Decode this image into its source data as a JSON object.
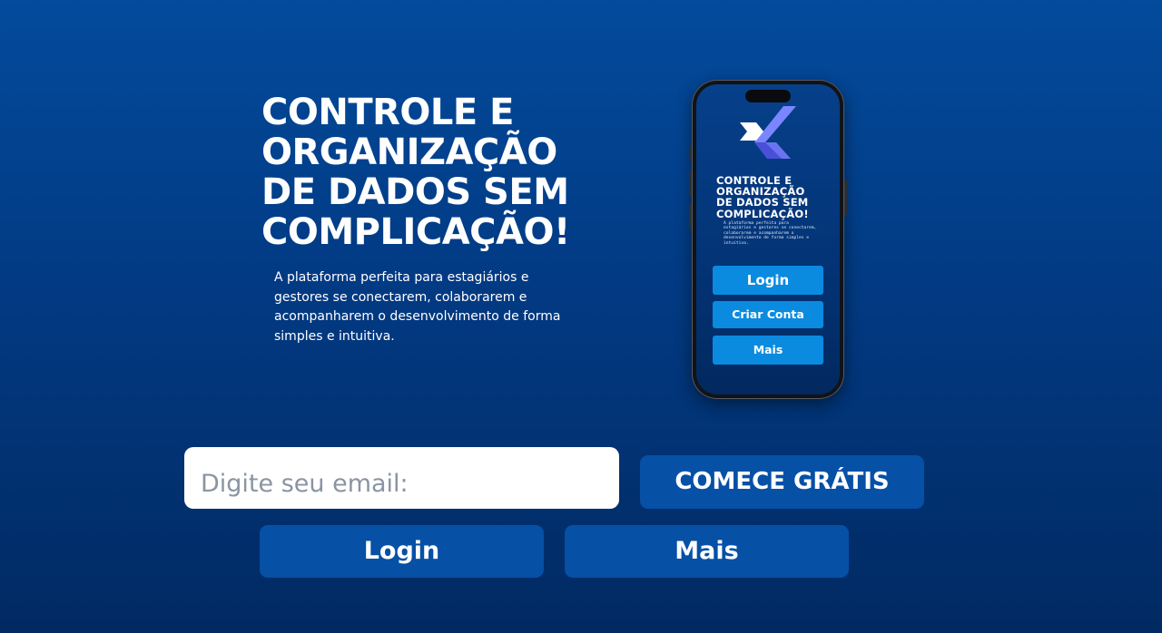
{
  "hero": {
    "title": "CONTROLE E\nORGANIZAÇÃO\nDE DADOS SEM\nCOMPLICAÇÃO!",
    "subtitle": "A plataforma perfeita para estagiários e gestores se conectarem, colaborarem e acompanharem o desenvolvimento de forma simples e intuitiva."
  },
  "phone": {
    "logo_icon": "x-logo-icon",
    "title": "CONTROLE E\nORGANIZAÇÃO\nDE DADOS SEM\nCOMPLICAÇÃO!",
    "description": "A plataforma perfeita para estagiários e gestores se conectarem, colaborarem e acompanharem o desenvolvimento de forma simples e intuitiva.",
    "buttons": {
      "login": "Login",
      "create_account": "Criar Conta",
      "more": "Mais"
    }
  },
  "form": {
    "email_placeholder": "Digite seu email:",
    "email_value": "",
    "start_button": "COMECE GRÁTIS",
    "login_button": "Login",
    "more_button": "Mais"
  },
  "colors": {
    "background_top": "#034b9c",
    "background_bottom": "#012a62",
    "button": "#0650a6",
    "phone_button": "#0a8be0",
    "logo_light": "#7a86ff",
    "logo_dark": "#4a4fd8"
  }
}
